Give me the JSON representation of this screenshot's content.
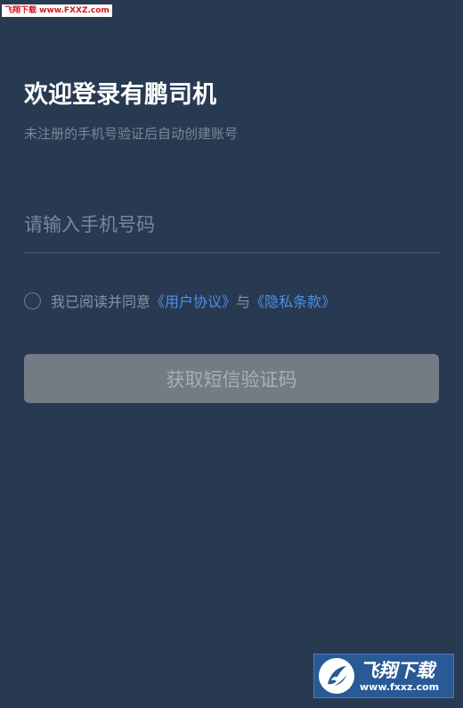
{
  "watermark": {
    "top_text": "飞翔下载 www.FXXZ.com",
    "bottom_cn": "飞翔下载",
    "bottom_en": "www.fxxz.com"
  },
  "login": {
    "title": "欢迎登录有鹏司机",
    "subtitle": "未注册的手机号验证后自动创建账号",
    "phone_placeholder": "请输入手机号码",
    "agreement": {
      "prefix": "我已阅读并同意",
      "user_agreement_link": "《用户协议》",
      "connector": "与",
      "privacy_link": "《隐私条款》"
    },
    "submit_label": "获取短信验证码"
  },
  "colors": {
    "background": "#283a52",
    "link": "#4e90e6",
    "button_disabled": "#737b84"
  }
}
